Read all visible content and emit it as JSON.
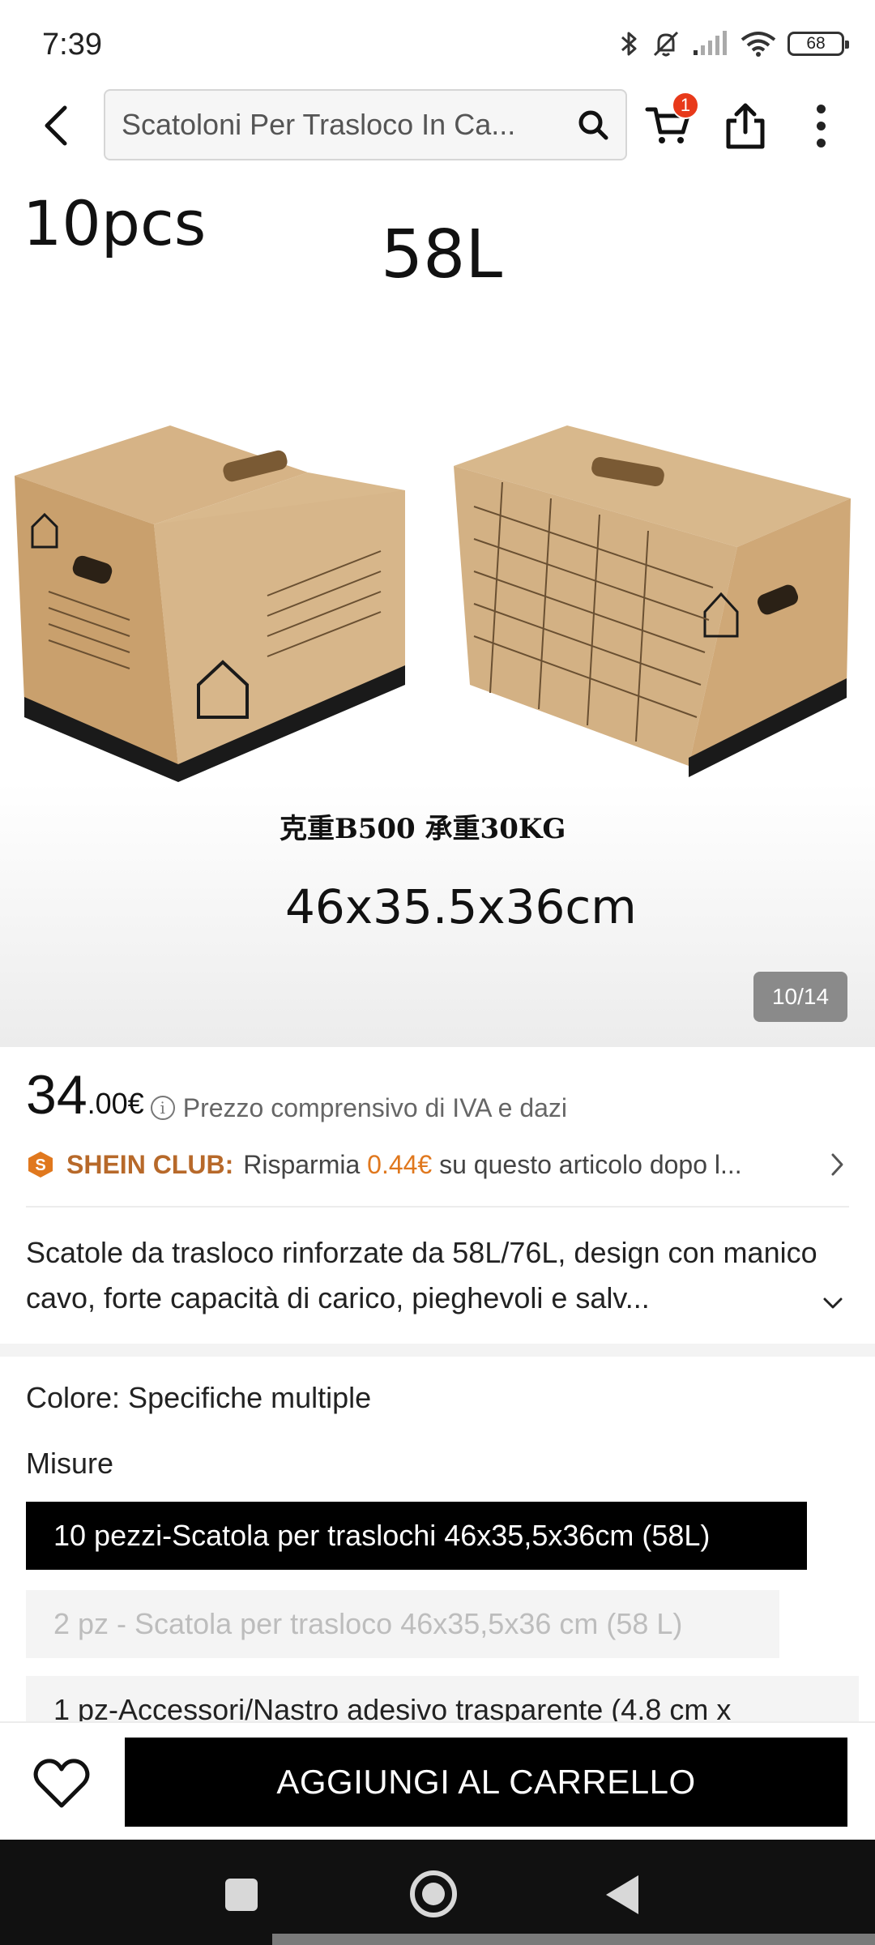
{
  "status_bar": {
    "time": "7:39",
    "battery": "68",
    "icons": [
      "bluetooth-icon",
      "mute-icon",
      "signal-icon",
      "wifi-icon",
      "battery-icon"
    ]
  },
  "header": {
    "search_text": "Scatoloni Per Trasloco In Ca...",
    "cart_count": "1",
    "icons": [
      "back-arrow-icon",
      "search-icon",
      "cart-icon",
      "share-icon",
      "more-vertical-icon"
    ]
  },
  "gallery": {
    "pieces_text": "10pcs",
    "volume_text": "58L",
    "spec_text": "克重B500 承重30KG",
    "size_text": "46x35.5x36cm",
    "counter": "10/14"
  },
  "price": {
    "integer": "34",
    "decimal": ".00€",
    "note": "Prezzo comprensivo di IVA e dazi"
  },
  "club": {
    "name": "SHEIN CLUB:",
    "text_before": "Risparmia ",
    "amount": "0.44€",
    "text_after": " su questo articolo dopo l..."
  },
  "description": "Scatole da trasloco rinforzate da 58L/76L, design con manico cavo, forte capacità di carico, pieghevoli e salv...",
  "options": {
    "color_label": "Colore: Specifiche multiple",
    "size_label": "Misure",
    "sizes": [
      {
        "label": "10 pezzi-Scatola per traslochi 46x35,5x36cm (58L)",
        "state": "selected"
      },
      {
        "label": "2 pz - Scatola per trasloco 46x35,5x36 cm (58 L)",
        "state": "disabled"
      },
      {
        "label": "1 pz-Accessori/Nastro adesivo trasparente (4.8 cm x",
        "state": "normal"
      }
    ]
  },
  "actions": {
    "add_to_cart": "AGGIUNGI AL CARRELLO"
  },
  "colors": {
    "primary": "#000000",
    "badge": "#e8391a",
    "club": "#b7692a",
    "club_amount": "#e0781e"
  }
}
